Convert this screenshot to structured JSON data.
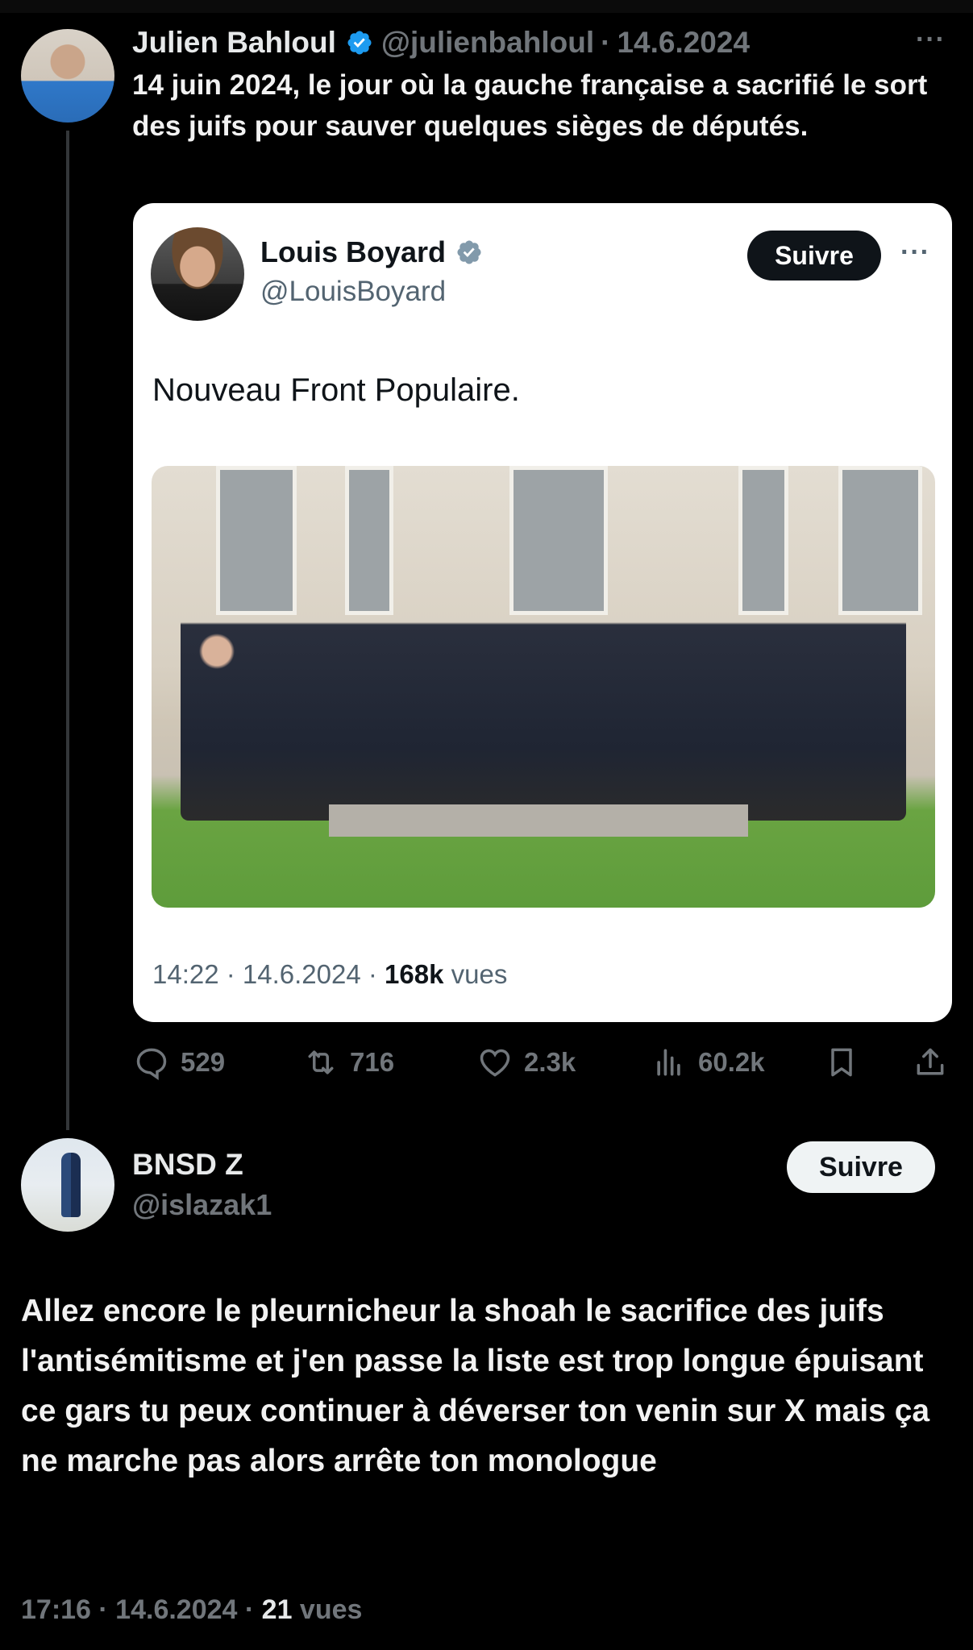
{
  "tweet": {
    "author_name": "Julien Bahloul",
    "handle": "@julienbahloul",
    "separator": "·",
    "date": "14.6.2024",
    "more_label": "···",
    "text": "14 juin 2024, le jour où la gauche française a sacrifié le sort des juifs pour sauver quelques sièges de députés.",
    "verified": true,
    "colors": {
      "verified_badge": "#1d9bf0",
      "background": "#000000",
      "muted": "#71767b"
    }
  },
  "quoted": {
    "author_name": "Louis Boyard",
    "handle": "@LouisBoyard",
    "follow_label": "Suivre",
    "more_label": "···",
    "text": "Nouveau Front Populaire.",
    "meta_time": "14:22 · 14.6.2024 · ",
    "meta_views_count": "168k",
    "meta_views_label": " vues",
    "verified": true
  },
  "actions": {
    "reply_count": "529",
    "repost_count": "716",
    "like_count": "2.3k",
    "views_count": "60.2k",
    "icons": [
      "reply-icon",
      "repost-icon",
      "like-icon",
      "views-icon",
      "bookmark-icon",
      "share-icon"
    ]
  },
  "reply": {
    "author_name": "BNSD Z",
    "handle": "@islazak1",
    "follow_label": "Suivre",
    "text": "Allez encore le pleurnicheur la shoah le sacrifice des juifs l'antisémitisme et j'en passe la liste est trop longue épuisant ce gars tu peux continuer à déverser ton venin sur X mais ça ne marche pas alors arrête ton monologue",
    "meta_time": "17:16 · 14.6.2024 · ",
    "meta_views_count": "21",
    "meta_views_label": " vues"
  }
}
